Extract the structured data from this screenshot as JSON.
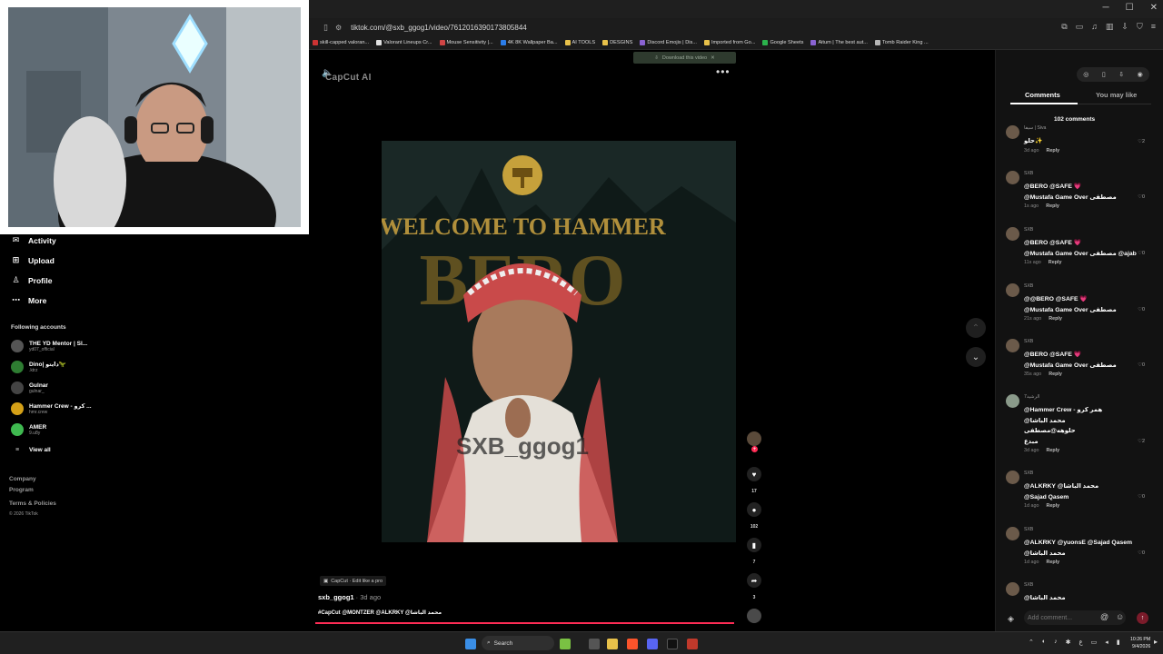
{
  "browser": {
    "url": "tiktok.com/@sxb_ggog1/video/7612016390173805844",
    "bookmarks": [
      "skill-capped valoran...",
      "Valorant Lineups Cr...",
      "Mouse Sensitivity |...",
      "4K 8K Wallpaper Ba...",
      "AI TOOLS",
      "DESGINS",
      "Discord Emojis | Dis...",
      "Imported from Go...",
      "Google Sheets",
      "Aitum | The best aut...",
      "Tomb Raider King ..."
    ]
  },
  "sidebar": {
    "nav": [
      {
        "label": "Activity",
        "icon": "activity-icon"
      },
      {
        "label": "Upload",
        "icon": "upload-icon"
      },
      {
        "label": "Profile",
        "icon": "profile-icon"
      },
      {
        "label": "More",
        "icon": "more-icon"
      }
    ],
    "following_header": "Following accounts",
    "accounts": [
      {
        "name": "THE YD Mentor | Sl...",
        "handle": "yd07_official",
        "color": "#555"
      },
      {
        "name": "Dino| دايتو🦖",
        "handle": ".ktrz",
        "color": "#2e7d32"
      },
      {
        "name": "Gulnar",
        "handle": "gulnar_",
        "color": "#444"
      },
      {
        "name": "Hammer Crew - كرو ...",
        "handle": "hmr.crew",
        "color": "#d4a017"
      },
      {
        "name": "AMER",
        "handle": "9.u8y",
        "color": "#3fb950"
      }
    ],
    "view_all": "View all",
    "footer": [
      "Company",
      "Program",
      "Terms & Policies",
      "© 2026 TikTok"
    ]
  },
  "video": {
    "watermark": "CapCut AI",
    "download_label": "Download this video",
    "title_text": "WELCOME TO HAMMER",
    "title_text2": "BERO",
    "overlay_handle": "SXB_ggog1",
    "edit_tag": "CapCut · Edit like a pro",
    "author": "sxb_ggog1",
    "posted": " · 3d ago",
    "caption": "#CapCut @MONTZER @ALKRKY @محمد الباشا"
  },
  "actions": {
    "likes": "17",
    "comments": "102",
    "saves": "7",
    "shares": "3"
  },
  "panel": {
    "tabs": [
      "Comments",
      "You may like"
    ],
    "count": "102 comments",
    "comments": [
      {
        "user": "سيفا | Siva",
        "lines": [
          "حلو✨"
        ],
        "time": "3d ago",
        "likes": "2",
        "color": "#6b5a4a"
      },
      {
        "user": "SXB",
        "lines": [
          "@BERO @SAFE 💗",
          "@Mustafa Game Over مصطفى"
        ],
        "time": "1s ago",
        "likes": "0",
        "color": "#6b5a4a"
      },
      {
        "user": "SXB",
        "lines": [
          "@BERO @SAFE 💗",
          "@Mustafa Game Over مصطفى @ajab"
        ],
        "time": "11s ago",
        "likes": "0",
        "color": "#6b5a4a"
      },
      {
        "user": "SXB",
        "lines": [
          "@@BERO @SAFE 💗",
          "@Mustafa Game Over مصطفى"
        ],
        "time": "21s ago",
        "likes": "0",
        "color": "#6b5a4a"
      },
      {
        "user": "SXB",
        "lines": [
          "@BERO @SAFE 💗",
          "@Mustafa Game Over مصطفى"
        ],
        "time": "35s ago",
        "likes": "0",
        "color": "#6b5a4a"
      },
      {
        "user": "الرشيد7",
        "lines": [
          "@Hammer Crew - همر كرو",
          "@محمد الباشا",
          "حلوهه@مصطفى",
          "مبدع"
        ],
        "time": "3d ago",
        "likes": "2",
        "color": "#8a9a8a"
      },
      {
        "user": "SXB",
        "lines": [
          "@ALKRKY @محمد الباشا",
          "@Sajad Qasem"
        ],
        "time": "1d ago",
        "likes": "0",
        "color": "#6b5a4a"
      },
      {
        "user": "SXB",
        "lines": [
          "@ALKRKY @yuonsE @Sajad Qasem",
          "@محمد الباشا"
        ],
        "time": "1d ago",
        "likes": "0",
        "color": "#6b5a4a"
      },
      {
        "user": "SXB",
        "lines": [
          "@محمد الباشا"
        ],
        "time": "",
        "likes": "",
        "color": "#6b5a4a"
      }
    ],
    "reply_label": "Reply",
    "add_placeholder": "Add comment..."
  },
  "taskbar": {
    "search": "Search",
    "time": "10:26 PM",
    "date": "9/4/2026"
  },
  "colors": {
    "accent": "#fe2c55",
    "panel": "#121212"
  }
}
